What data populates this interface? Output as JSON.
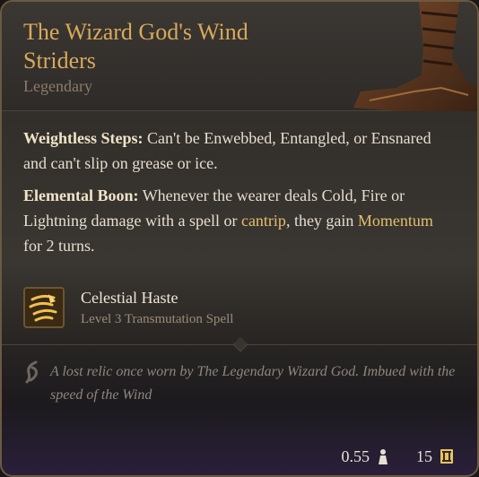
{
  "item": {
    "title": "The Wizard God's Wind Striders",
    "rarity": "Legendary"
  },
  "properties": [
    {
      "name": "Weightless Steps:",
      "text": "Can't be Enwebbed, Entangled, or Ensnared and can't slip on grease or ice."
    },
    {
      "name": "Elemental Boon:",
      "text_before": "Whenever the wearer deals Cold, Fire or Lightning damage with a spell or ",
      "keyword_1": "cantrip",
      "text_middle": ", they gain ",
      "keyword_2": "Momentum",
      "text_after": " for 2 turns."
    }
  ],
  "spell": {
    "name": "Celestial Haste",
    "subtitle": "Level 3 Transmutation Spell",
    "icon": "celestial-haste-icon"
  },
  "lore": {
    "text": "A lost relic once worn by The Legendary Wizard God. Imbued with the speed of the Wind",
    "icon": "feather-icon"
  },
  "footer": {
    "weight": "0.55",
    "weight_icon": "weight-icon",
    "value": "15",
    "value_icon": "gold-coin-icon"
  },
  "colors": {
    "title": "#d9a95a",
    "keyword": "#e3bf6e",
    "rarity": "#8c7c6b",
    "body_text": "#e6ded0",
    "lore_text": "#8f877d"
  }
}
